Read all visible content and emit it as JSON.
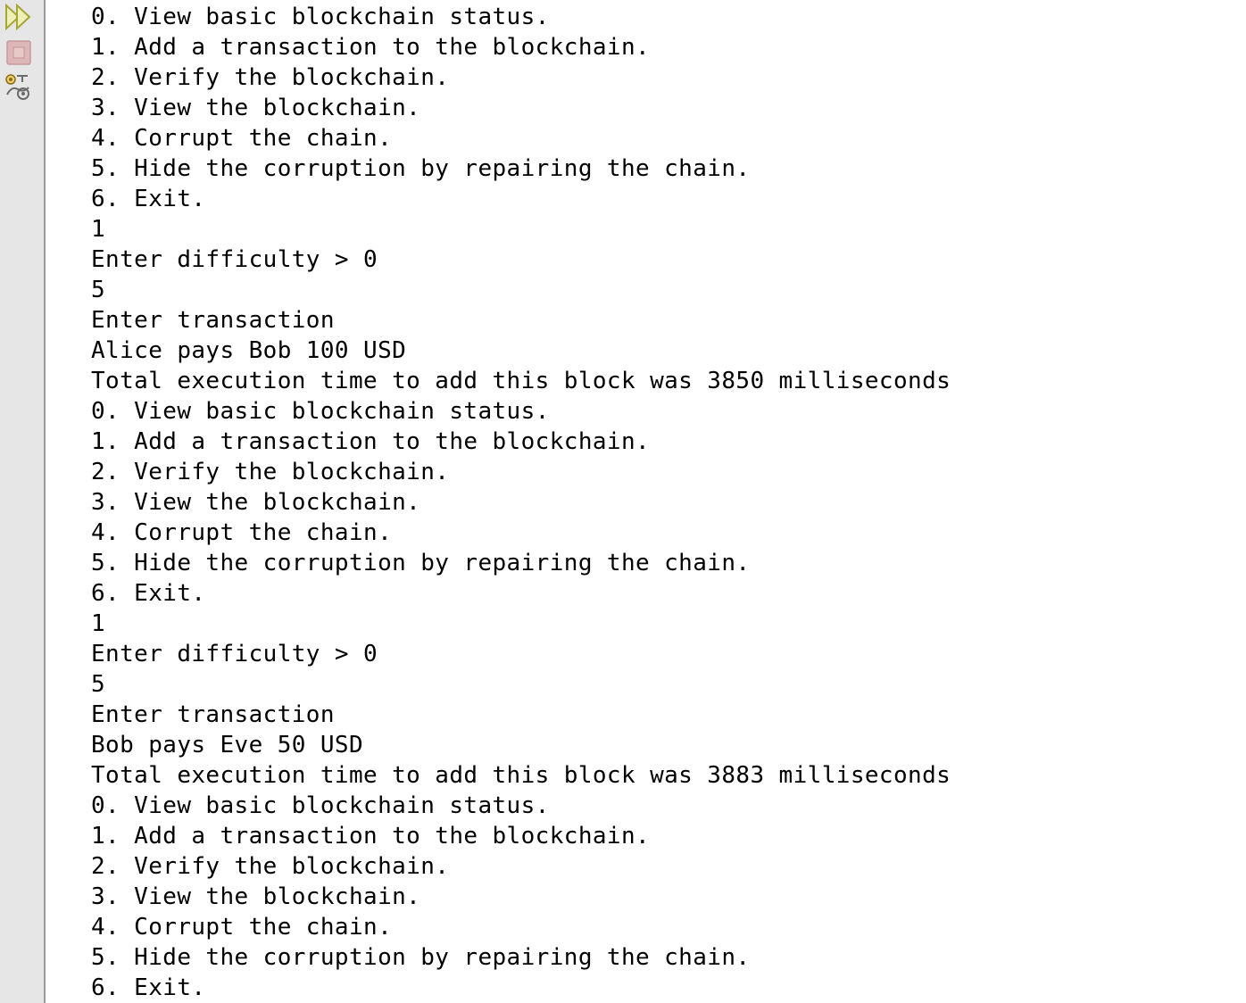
{
  "toolbar": {
    "rerun_icon": "double-play-icon",
    "stop_icon": "stop-icon",
    "settings_icon": "settings-icon",
    "colors": {
      "rerun": "#c8c84a",
      "stop": "#d9a0a0",
      "settings": "#6b6b6b"
    }
  },
  "console": {
    "lines": [
      "0. View basic blockchain status.",
      "1. Add a transaction to the blockchain.",
      "2. Verify the blockchain.",
      "3. View the blockchain.",
      "4. Corrupt the chain.",
      "5. Hide the corruption by repairing the chain.",
      "6. Exit.",
      "1",
      "Enter difficulty > 0",
      "5",
      "Enter transaction",
      "Alice pays Bob 100 USD",
      "Total execution time to add this block was 3850 milliseconds",
      "0. View basic blockchain status.",
      "1. Add a transaction to the blockchain.",
      "2. Verify the blockchain.",
      "3. View the blockchain.",
      "4. Corrupt the chain.",
      "5. Hide the corruption by repairing the chain.",
      "6. Exit.",
      "1",
      "Enter difficulty > 0",
      "5",
      "Enter transaction",
      "Bob pays Eve 50 USD",
      "Total execution time to add this block was 3883 milliseconds",
      "0. View basic blockchain status.",
      "1. Add a transaction to the blockchain.",
      "2. Verify the blockchain.",
      "3. View the blockchain.",
      "4. Corrupt the chain.",
      "5. Hide the corruption by repairing the chain.",
      "6. Exit."
    ]
  }
}
